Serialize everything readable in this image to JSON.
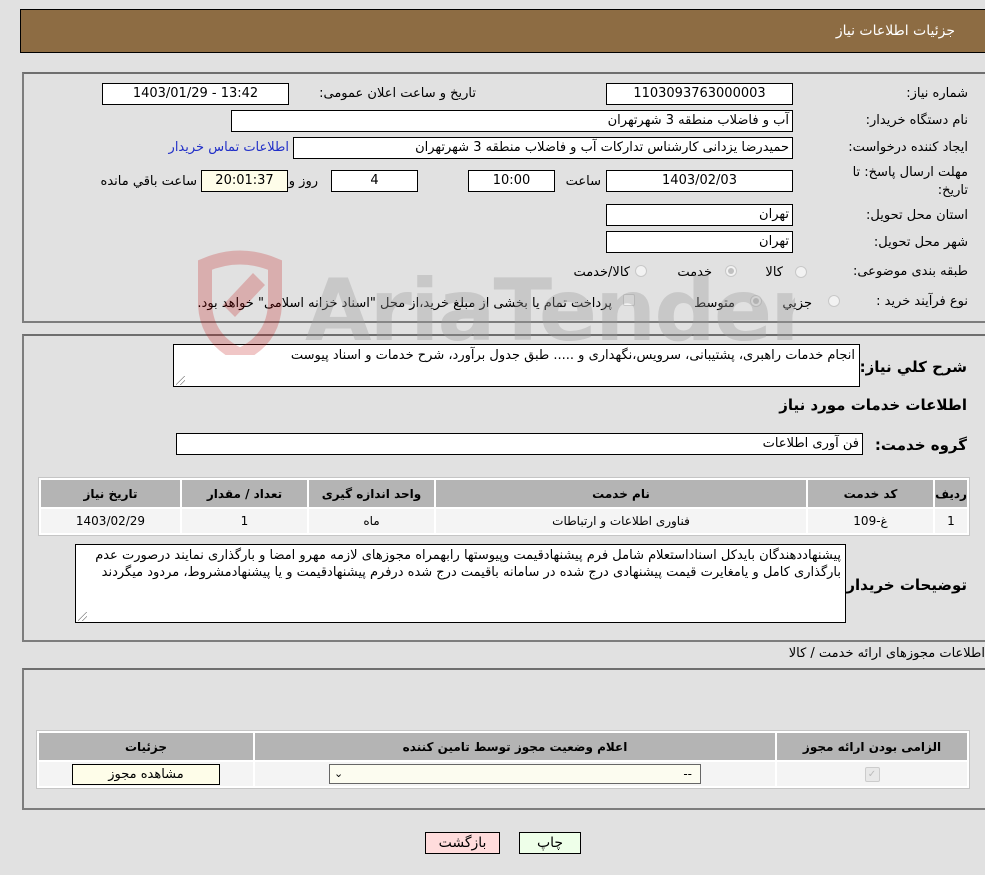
{
  "header": {
    "title": "جزئیات اطلاعات نیاز"
  },
  "details": {
    "need_number_label": "شماره نیاز:",
    "need_number": "1103093763000003",
    "announce_label": "تاریخ و ساعت اعلان عمومی:",
    "announce_value": "1403/01/29 - 13:42",
    "buyer_org_label": "نام دستگاه خریدار:",
    "buyer_org": "آب و فاضلاب منطقه 3 شهرتهران",
    "creator_label": "ایجاد کننده درخواست:",
    "creator": "حمیدرضا یزدانی کارشناس تدارکات آب و فاضلاب منطقه 3 شهرتهران",
    "contact_link": "اطلاعات تماس خریدار",
    "deadline_label_1": "مهلت ارسال پاسخ: تا",
    "deadline_label_2": "تاریخ:",
    "deadline_date": "1403/02/03",
    "time_label": "ساعت",
    "deadline_time": "10:00",
    "days_value": "4",
    "days_label": "روز و",
    "remaining_time": "20:01:37",
    "remaining_label": "ساعت باقي مانده",
    "province_label": "استان محل تحویل:",
    "province": "تهران",
    "city_label": "شهر محل تحویل:",
    "city": "تهران",
    "category_label": "طبقه بندی موضوعی:",
    "category_options": [
      {
        "label": "کالا",
        "checked": false
      },
      {
        "label": "خدمت",
        "checked": true
      },
      {
        "label": "کالا/خدمت",
        "checked": false
      }
    ],
    "process_label": "نوع فرآیند خرید :",
    "process_options": [
      {
        "label": "جزيي",
        "checked": false
      },
      {
        "label": "متوسط",
        "checked": true
      }
    ],
    "treasury_checkbox_label": "پرداخت تمام یا بخشی از مبلغ خرید،از محل \"اسناد خزانه اسلامی\" خواهد بود."
  },
  "summary": {
    "label": "شرح کلي نياز:",
    "text": "انجام خدمات راهبری، پشتیبانی، سرویس،نگهداری و ..... طبق جدول برآورد، شرح خدمات و اسناد پیوست",
    "services_heading": "اطلاعات خدمات مورد نیاز",
    "service_group_label": "گروه خدمت:",
    "service_group": "فن آوری اطلاعات"
  },
  "services_table": {
    "columns": [
      "ردیف",
      "کد خدمت",
      "نام خدمت",
      "واحد اندازه گیری",
      "تعداد / مقدار",
      "تاریخ نیاز"
    ],
    "rows": [
      [
        "1",
        "غ-109",
        "فناوری اطلاعات و ارتباطات",
        "ماه",
        "1",
        "1403/02/29"
      ]
    ]
  },
  "buyer_notes": {
    "label": "توضیحات خریدار:",
    "text": "پیشنهاددهندگان بایدکل اسناداستعلام شامل فرم پیشنهادقیمت وپیوستها رابهمراه مجوزهای لازمه مهرو امضا و بارگذاری نمایند درصورت عدم بارگذاری کامل و یامغایرت قیمت پیشنهادی درج شده در سامانه باقیمت درج شده درفرم پیشنهادقیمت و یا پیشنهادمشروط، مردود میگردند"
  },
  "permits": {
    "section_title": "اطلاعات مجوزهای ارائه خدمت / کالا",
    "columns": [
      "الزامی بودن ارائه مجوز",
      "اعلام وضعیت مجوز توسط تامین کننده",
      "جزئیات"
    ],
    "row": {
      "required_checked": true,
      "status_selected": "--",
      "details_button": "مشاهده مجوز"
    }
  },
  "footer": {
    "print_button": "چاپ",
    "back_button": "بازگشت"
  },
  "watermark": {
    "text": "AriaTender.neT"
  }
}
